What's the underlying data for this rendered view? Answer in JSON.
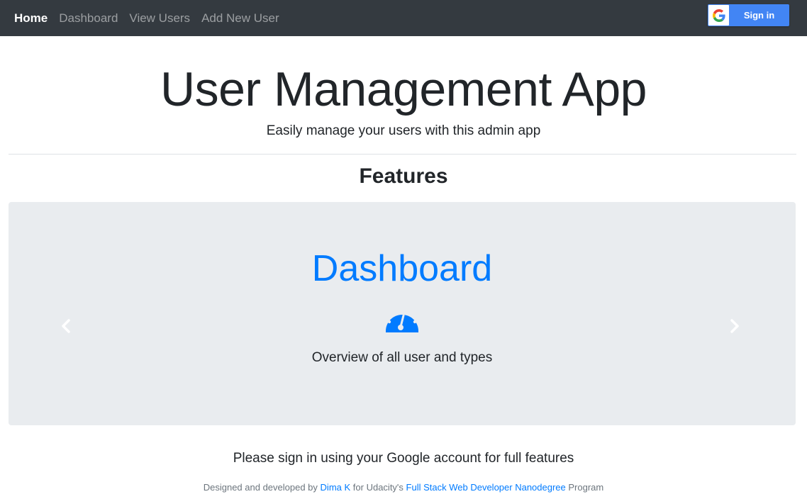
{
  "navbar": {
    "links": [
      {
        "label": "Home",
        "active": true
      },
      {
        "label": "Dashboard",
        "active": false
      },
      {
        "label": "View Users",
        "active": false
      },
      {
        "label": "Add New User",
        "active": false
      }
    ],
    "signin_label": "Sign in",
    "signin_icon": "google-g-icon"
  },
  "header": {
    "title": "User Management App",
    "subtitle": "Easily manage your users with this admin app"
  },
  "features": {
    "heading": "Features",
    "slide": {
      "title": "Dashboard",
      "icon": "tachometer-icon",
      "text": "Overview of all user and types"
    },
    "prev_icon": "chevron-left-icon",
    "next_icon": "chevron-right-icon"
  },
  "footer": {
    "signin_note": "Please sign in using your Google account for full features",
    "credits_prefix": "Designed and developed by",
    "author": "Dima K",
    "credits_middle": "for Udacity's",
    "program_link": "Full Stack Web Developer Nanodegree",
    "credits_suffix": "Program"
  },
  "colors": {
    "navbar_bg": "#343a40",
    "primary": "#007bff",
    "google_blue": "#4285f4",
    "carousel_bg": "#e9ecef"
  }
}
